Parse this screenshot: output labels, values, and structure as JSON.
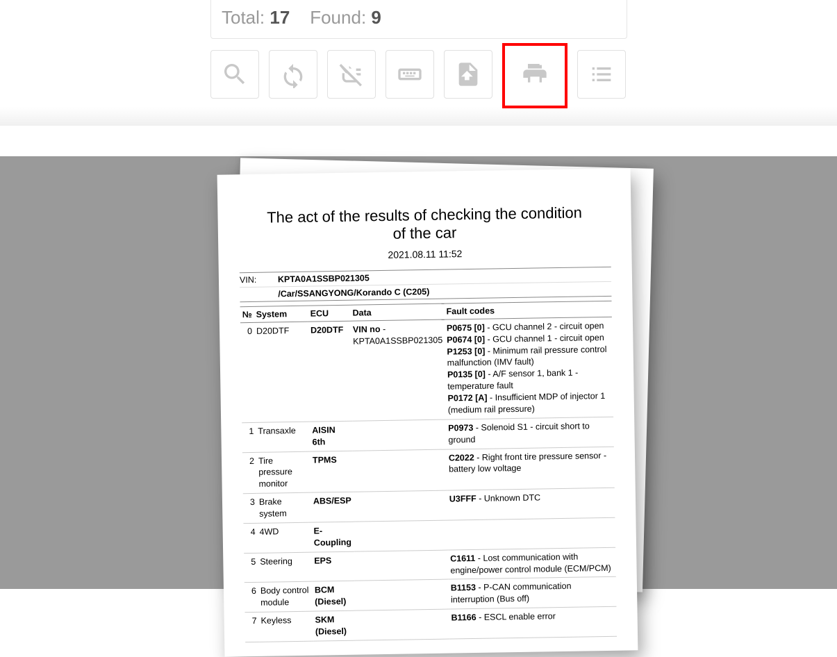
{
  "stats": {
    "total_label": "Total:",
    "total_value": "17",
    "found_label": "Found:",
    "found_value": "9"
  },
  "toolbar": {
    "search": "search-icon",
    "refresh": "refresh-icon",
    "disconnect": "unplug-icon",
    "keyboard": "keyboard-icon",
    "export": "export-doc-icon",
    "print": "print-icon",
    "list": "list-icon"
  },
  "report": {
    "title": "The act of the results of checking the condition of the car",
    "date": "2021.08.11 11:52",
    "vin_label": "VIN:",
    "vin_value": "KPTA0A1SSBP021305",
    "vehicle_path": "/Car/SSANGYONG/Korando C (C205)",
    "headers": {
      "num": "№",
      "system": "System",
      "ecu": "ECU",
      "data": "Data",
      "faults": "Fault codes"
    },
    "rows": [
      {
        "n": "0",
        "system": "D20DTF",
        "ecu": "D20DTF",
        "data_k": "VIN no",
        "data_v": " - KPTA0A1SSBP021305",
        "faults": [
          {
            "code": "P0675 [0]",
            "desc": " - GCU channel 2 - circuit open"
          },
          {
            "code": "P0674 [0]",
            "desc": " - GCU channel 1 - circuit open"
          },
          {
            "code": "P1253 [0]",
            "desc": " - Minimum rail pressure control malfunction (IMV fault)"
          },
          {
            "code": "P0135 [0]",
            "desc": " - A/F sensor 1, bank 1 - temperature fault"
          },
          {
            "code": "P0172 [A]",
            "desc": " - Insufficient MDP of injector 1 (medium rail pressure)"
          }
        ]
      },
      {
        "n": "1",
        "system": "Transaxle",
        "ecu": "AISIN 6th",
        "data_k": "",
        "data_v": "",
        "faults": [
          {
            "code": "P0973",
            "desc": " - Solenoid S1 - circuit short to ground"
          }
        ]
      },
      {
        "n": "2",
        "system": "Tire pressure monitor",
        "ecu": "TPMS",
        "data_k": "",
        "data_v": "",
        "faults": [
          {
            "code": "C2022",
            "desc": " - Right front tire pressure sensor - battery low voltage"
          }
        ]
      },
      {
        "n": "3",
        "system": "Brake system",
        "ecu": "ABS/ESP",
        "data_k": "",
        "data_v": "",
        "faults": [
          {
            "code": "U3FFF",
            "desc": " - Unknown DTC"
          }
        ]
      },
      {
        "n": "4",
        "system": "4WD",
        "ecu": "E-Coupling",
        "data_k": "",
        "data_v": "",
        "faults": []
      },
      {
        "n": "5",
        "system": "Steering",
        "ecu": "EPS",
        "data_k": "",
        "data_v": "",
        "faults": [
          {
            "code": "C1611",
            "desc": " - Lost communication with engine/power control module (ECM/PCM)"
          }
        ]
      },
      {
        "n": "6",
        "system": "Body control module",
        "ecu": "BCM (Diesel)",
        "data_k": "",
        "data_v": "",
        "faults": [
          {
            "code": "B1153",
            "desc": " - P-CAN communication interruption (Bus off)"
          }
        ]
      },
      {
        "n": "7",
        "system": "Keyless",
        "ecu": "SKM (Diesel)",
        "data_k": "",
        "data_v": "",
        "faults": [
          {
            "code": "B1166",
            "desc": " - ESCL enable error"
          }
        ]
      }
    ]
  }
}
